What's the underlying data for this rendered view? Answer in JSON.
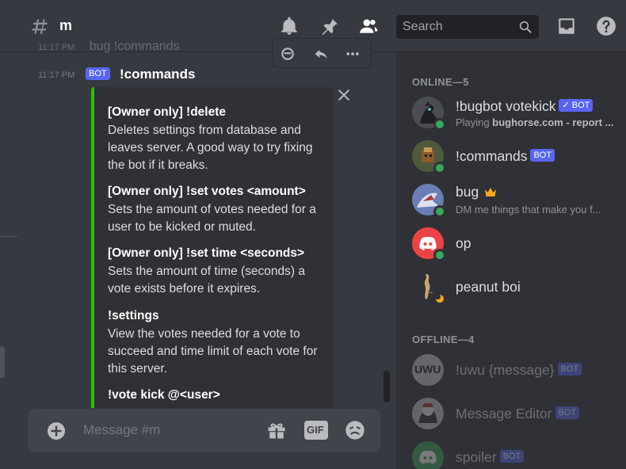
{
  "header": {
    "channel_name": "m",
    "search_placeholder": "Search",
    "icons": [
      "hashtag-icon",
      "bell-icon",
      "pin-icon",
      "members-icon",
      "search-icon",
      "inbox-icon",
      "help-icon"
    ]
  },
  "messages": {
    "ghost": {
      "time": "11:17 PM",
      "text": "bug  !commands"
    },
    "current": {
      "time": "11:17 PM",
      "bot_tag": "BOT",
      "text": "!commands"
    }
  },
  "embed": {
    "accent": "#28c400",
    "fields": [
      {
        "name": "[Owner only] !delete",
        "value": "Deletes settings from database and leaves server. A good way to try fixing the bot if it breaks."
      },
      {
        "name": "[Owner only] !set votes <amount>",
        "value": "Sets the amount of votes needed for a user to be kicked or muted."
      },
      {
        "name": "[Owner only] !set time <seconds>",
        "value": "Sets the amount of time (seconds) a vote exists before it expires."
      },
      {
        "name": "!settings",
        "value": "View the votes needed for a vote to succeed and time limit of each vote for this server."
      },
      {
        "name": "!vote kick @<user>",
        "value": ""
      }
    ]
  },
  "composer": {
    "placeholder": "Message #m",
    "gif_label": "GIF"
  },
  "members": {
    "online_header": "ONLINE—5",
    "offline_header": "OFFLINE—4",
    "online": [
      {
        "name": "!bugbot votekick",
        "tag": "✓ BOT",
        "sub_prefix": "Playing ",
        "sub_bold": "bughorse.com - report ...",
        "status": "online"
      },
      {
        "name": "!commands",
        "tag": "BOT",
        "status": "online"
      },
      {
        "name": "bug",
        "sub": "DM me things that make you f...",
        "status": "online"
      },
      {
        "name": "op",
        "status": "online"
      },
      {
        "name": "peanut boi",
        "status": "idle"
      }
    ],
    "offline": [
      {
        "name": "!uwu {message}",
        "tag": "BOT",
        "avatar_text": "UWU"
      },
      {
        "name": "Message Editor",
        "tag": "BOT"
      },
      {
        "name": "spoiler",
        "tag": "BOT"
      }
    ]
  },
  "colors": {
    "bg": "#36393f",
    "sidebar": "#2f3136",
    "blurple": "#5865f2",
    "online": "#3ba55c",
    "idle": "#faa81a"
  }
}
